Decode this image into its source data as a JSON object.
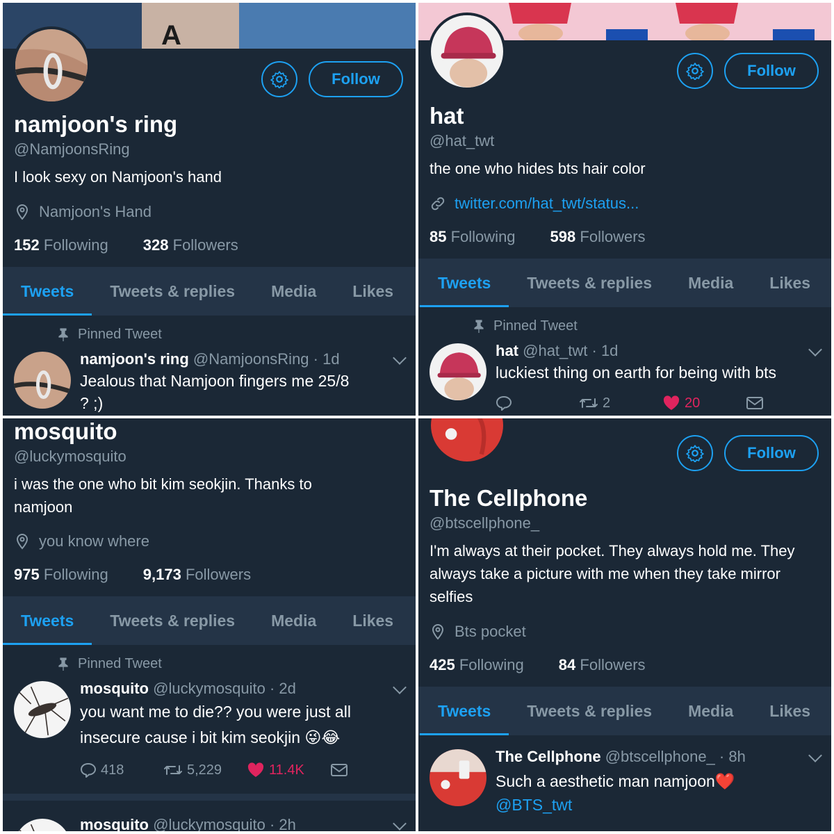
{
  "panels": [
    {
      "name": "namjoon's ring",
      "handle": "@NamjoonsRing",
      "bio": "I look sexy on Namjoon's hand",
      "location": "Namjoon's Hand",
      "following": "152",
      "followers": "328",
      "follow_label": "Follow",
      "tweet": {
        "pinned_label": "Pinned Tweet",
        "author": "namjoon's ring",
        "meta": "@NamjoonsRing · 1d",
        "text": "Jealous that Namjoon fingers me 25/8 ? ;)"
      }
    },
    {
      "name": "hat",
      "handle": "@hat_twt",
      "bio": "the one who hides bts hair color",
      "link": "twitter.com/hat_twt/status...",
      "following": "85",
      "followers": "598",
      "follow_label": "Follow",
      "tweet": {
        "pinned_label": "Pinned Tweet",
        "author": "hat",
        "meta": "@hat_twt · 1d",
        "text": "luckiest thing on earth for being with bts",
        "retweets": "2",
        "likes": "20"
      }
    },
    {
      "name": "mosquito",
      "handle": "@luckymosquito",
      "bio": "i was the one who bit kim seokjin. Thanks to namjoon",
      "location": "you know where",
      "following": "975",
      "followers": "9,173",
      "tweet": {
        "pinned_label": "Pinned Tweet",
        "author": "mosquito",
        "meta": "@luckymosquito · 2d",
        "text": "you want me to die?? you were just all insecure cause i bit kim seokjin 😜😂",
        "replies": "418",
        "retweets": "5,229",
        "likes": "11.4K"
      },
      "tweet2": {
        "author": "mosquito",
        "meta": "@luckymosquito · 2h"
      }
    },
    {
      "name": "The Cellphone",
      "handle": "@btscellphone_",
      "bio": "I'm always at their pocket. They always hold me. They always take a picture with me when they take mirror selfies",
      "location": "Bts pocket",
      "following": "425",
      "followers": "84",
      "follow_label": "Follow",
      "tweet": {
        "author": "The Cellphone",
        "meta": "@btscellphone_ · 8h",
        "text": "Such a aesthetic man namjoon❤️",
        "mention": "@BTS_twt"
      }
    }
  ],
  "labels": {
    "following": "Following",
    "followers": "Followers"
  },
  "tabs": [
    "Tweets",
    "Tweets & replies",
    "Media",
    "Likes"
  ],
  "colors": {
    "background": "#1b2836",
    "tabbar": "#243447",
    "accent": "#1da1f2",
    "muted": "#8899a6",
    "like": "#e0245e"
  }
}
